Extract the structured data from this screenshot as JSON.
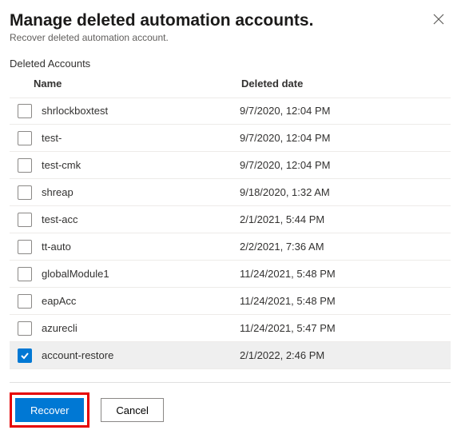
{
  "header": {
    "title": "Manage deleted automation accounts.",
    "subtitle": "Recover deleted automation account."
  },
  "section_label": "Deleted Accounts",
  "columns": {
    "name": "Name",
    "deleted_date": "Deleted date"
  },
  "rows": [
    {
      "name": "shrlockboxtest",
      "date": "9/7/2020, 12:04 PM",
      "checked": false
    },
    {
      "name": "test-",
      "date": "9/7/2020, 12:04 PM",
      "checked": false
    },
    {
      "name": "test-cmk",
      "date": "9/7/2020, 12:04 PM",
      "checked": false
    },
    {
      "name": "shreap",
      "date": "9/18/2020, 1:32 AM",
      "checked": false
    },
    {
      "name": "test-acc",
      "date": "2/1/2021, 5:44 PM",
      "checked": false
    },
    {
      "name": "tt-auto",
      "date": "2/2/2021, 7:36 AM",
      "checked": false
    },
    {
      "name": "globalModule1",
      "date": "11/24/2021, 5:48 PM",
      "checked": false
    },
    {
      "name": "eapAcc",
      "date": "11/24/2021, 5:48 PM",
      "checked": false
    },
    {
      "name": "azurecli",
      "date": "11/24/2021, 5:47 PM",
      "checked": false
    },
    {
      "name": "account-restore",
      "date": "2/1/2022, 2:46 PM",
      "checked": true
    }
  ],
  "footer": {
    "recover_label": "Recover",
    "cancel_label": "Cancel"
  }
}
